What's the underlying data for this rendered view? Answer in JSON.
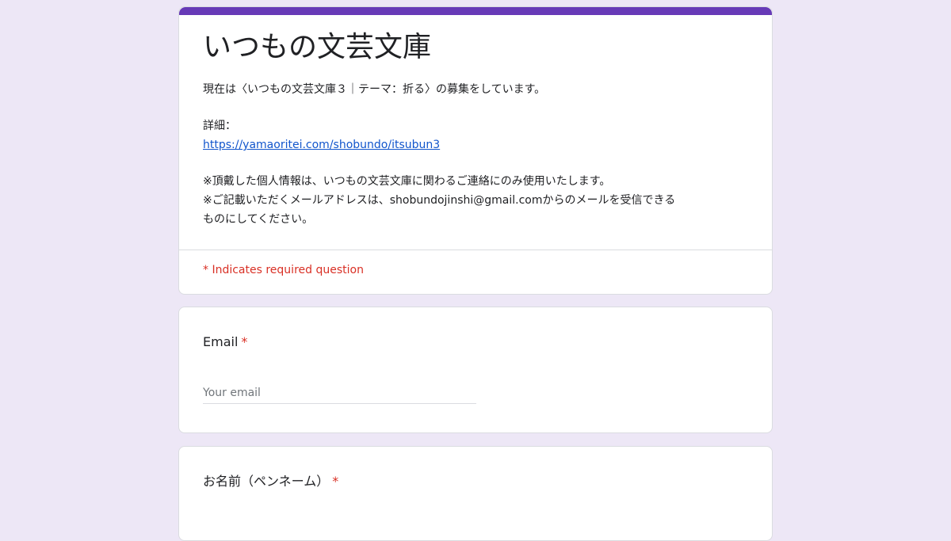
{
  "header": {
    "title": "いつもの文芸文庫",
    "description": {
      "line1": "現在は〈いつもの文芸文庫３｜テーマ：折る〉の募集をしています。",
      "details_label": "詳細：",
      "link": "https://yamaoritei.com/shobundo/itsubun3",
      "note1": "※頂戴した個人情報は、いつもの文芸文庫に関わるご連絡にのみ使用いたします。",
      "note2a": "※ご記載いただくメールアドレスは、shobundojinshi@gmail.comからのメールを受信できる",
      "note2b": "ものにしてください。"
    },
    "required_note": "* Indicates required question"
  },
  "questions": {
    "email": {
      "label": "Email",
      "required_mark": "*",
      "placeholder": "Your email",
      "value": ""
    },
    "name": {
      "label": "お名前（ペンネーム）",
      "required_mark": "*"
    }
  },
  "colors": {
    "accent": "#673ab7",
    "background": "#ede7f6",
    "required": "#d93025",
    "link": "#1155cc"
  }
}
